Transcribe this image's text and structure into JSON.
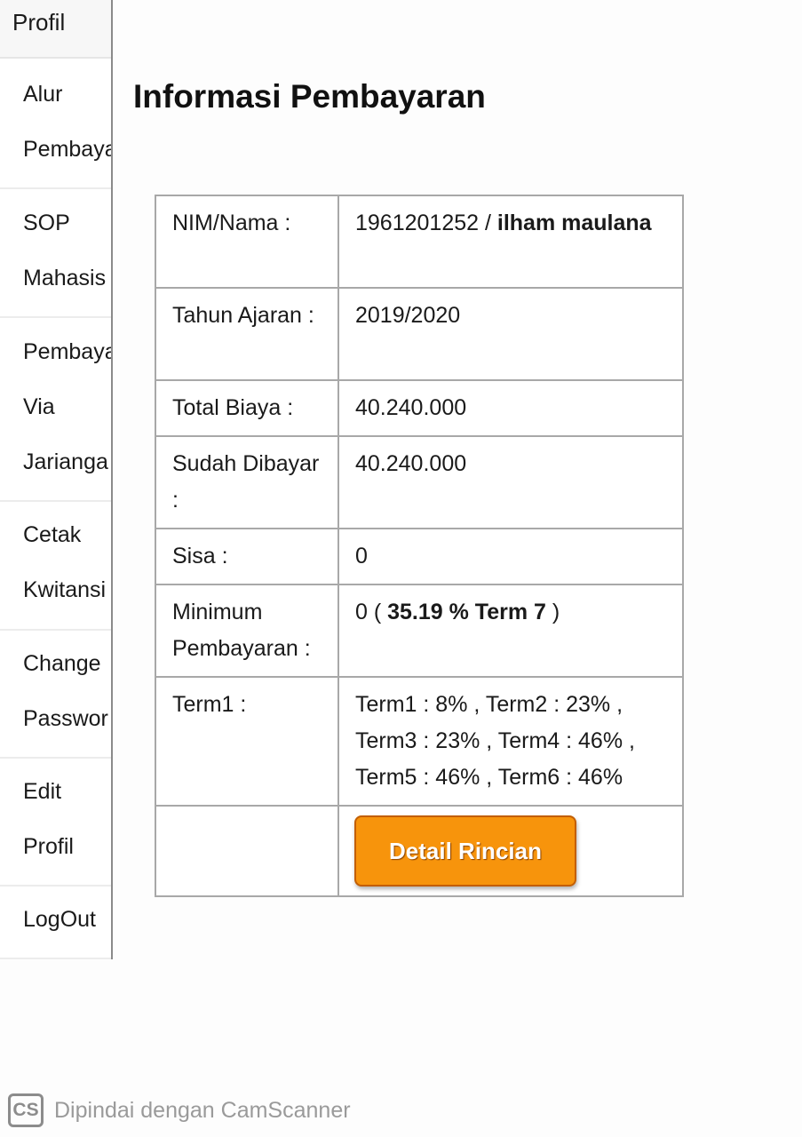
{
  "sidebar": {
    "profile": "Profil",
    "items": [
      {
        "line1": "Alur",
        "line2": "Pembaya"
      },
      {
        "line1": "SOP",
        "line2": "Mahasis"
      },
      {
        "line1": "Pembaya",
        "line2": "Via",
        "line3": "Jarianga"
      },
      {
        "line1": "Cetak",
        "line2": "Kwitansi"
      },
      {
        "line1": "Change",
        "line2": "Passwor"
      },
      {
        "line1": "Edit",
        "line2": "Profil"
      },
      {
        "line1": "LogOut"
      }
    ]
  },
  "main": {
    "title": "Informasi Pembayaran",
    "rows": {
      "nim": {
        "label": "NIM/Nama :",
        "nim_value": "1961201252 / ",
        "name_value": "ilham maulana"
      },
      "tahun": {
        "label": "Tahun Ajaran :",
        "value": "2019/2020"
      },
      "total": {
        "label": "Total Biaya :",
        "value": "40.240.000"
      },
      "sudah": {
        "label": "Sudah Dibayar :",
        "value": "40.240.000"
      },
      "sisa": {
        "label": "Sisa :",
        "value": "0"
      },
      "minimum": {
        "label": "Minimum Pembayaran :",
        "value_prefix": "0 ( ",
        "value_bold": "35.19 % Term 7",
        "value_suffix": " )"
      },
      "term": {
        "label": "Term1 :",
        "value": "Term1 : 8% , Term2 : 23% , Term3 : 23% , Term4 : 46% , Term5 : 46% , Term6 : 46%"
      }
    },
    "detail_button": "Detail Rincian"
  },
  "watermark": {
    "logo": "CS",
    "text": "Dipindai dengan CamScanner"
  },
  "colors": {
    "button_bg": "#f7940c",
    "button_border": "#c35e00",
    "sidebar_border": "#8a8a8a"
  }
}
